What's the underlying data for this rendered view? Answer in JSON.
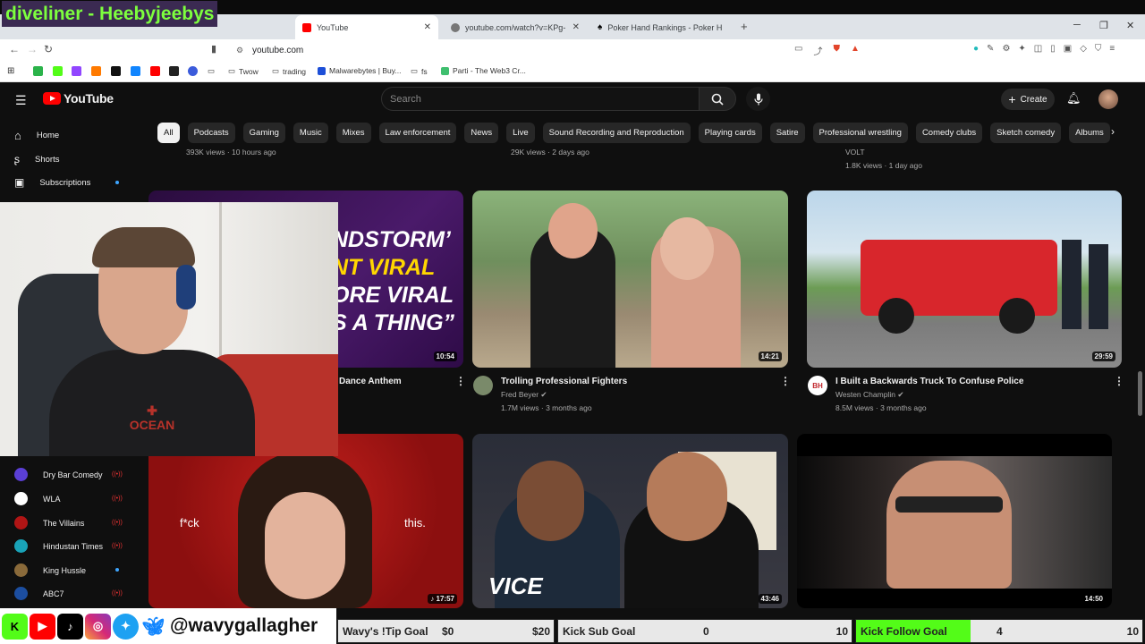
{
  "overlay": {
    "streamer_title": "diveliner - Heebyjeebys",
    "social_handle": "@wavygallagher"
  },
  "tabs": [
    {
      "label": "YouTube",
      "active": true
    },
    {
      "label": "youtube.com/watch?v=KPg-hM",
      "active": false
    },
    {
      "label": "Poker Hand Rankings - Poker Hands",
      "active": false
    }
  ],
  "address": {
    "url": "youtube.com"
  },
  "bookmarks": [
    "Twow",
    "trading",
    "Malwarebytes | Buy...",
    "fs",
    "Parti - The Web3 Cr..."
  ],
  "youtube": {
    "logo": "YouTube",
    "search_placeholder": "Search",
    "create_label": "Create",
    "nav": [
      {
        "label": "Home"
      },
      {
        "label": "Shorts"
      },
      {
        "label": "Subscriptions"
      }
    ],
    "subscriptions": [
      {
        "label": "Dry Bar Comedy",
        "color": "#5b3fd6"
      },
      {
        "label": "WLA",
        "color": "#ffffff"
      },
      {
        "label": "The Villains",
        "color": "#b01515"
      },
      {
        "label": "Hindustan Times",
        "color": "#19a3b8"
      },
      {
        "label": "King Hussle",
        "color": "#8a6a3a"
      },
      {
        "label": "ABC7",
        "color": "#1c4ea0"
      }
    ],
    "chips": [
      "All",
      "Podcasts",
      "Gaming",
      "Music",
      "Mixes",
      "Law enforcement",
      "News",
      "Live",
      "Sound Recording and Reproduction",
      "Playing cards",
      "Satire",
      "Professional wrestling",
      "Comedy clubs",
      "Sketch comedy",
      "Albums"
    ],
    "prev_row": [
      {
        "meta": "393K views · 10 hours ago"
      },
      {
        "meta": "29K views · 2 days ago"
      },
      {
        "channel": "VOLT",
        "meta": "1.8K views · 1 day ago"
      }
    ],
    "videos": [
      {
        "title": "Dance Anthem",
        "duration": "10:54",
        "thumb_text": [
          "NDSTORM’",
          "NT VIRAL",
          "ORE VIRAL",
          "S A THING”"
        ]
      },
      {
        "title": "Trolling Professional Fighters",
        "channel": "Fred Beyer",
        "meta": "1.7M views · 3 months ago",
        "duration": "14:21"
      },
      {
        "title": "I Built a Backwards Truck To Confuse Police",
        "channel": "Westen Champlin",
        "meta": "8.5M views · 3 months ago",
        "duration": "29:59",
        "channel_badge": "BH"
      },
      {
        "duration": "17:57",
        "thumb_left": "f*ck",
        "thumb_right": "this."
      },
      {
        "duration": "43:46",
        "thumb_logo": "VICE"
      },
      {
        "duration": "14:50"
      }
    ]
  },
  "goals": [
    {
      "label": "Wavy's !Tip Goal",
      "current": "$0",
      "target": "$20",
      "progress": 0
    },
    {
      "label": "Kick Sub Goal",
      "current": "0",
      "target": "10",
      "progress": 0
    },
    {
      "label": "Kick Follow Goal",
      "current": "4",
      "target": "10",
      "progress": 0.4
    }
  ]
}
